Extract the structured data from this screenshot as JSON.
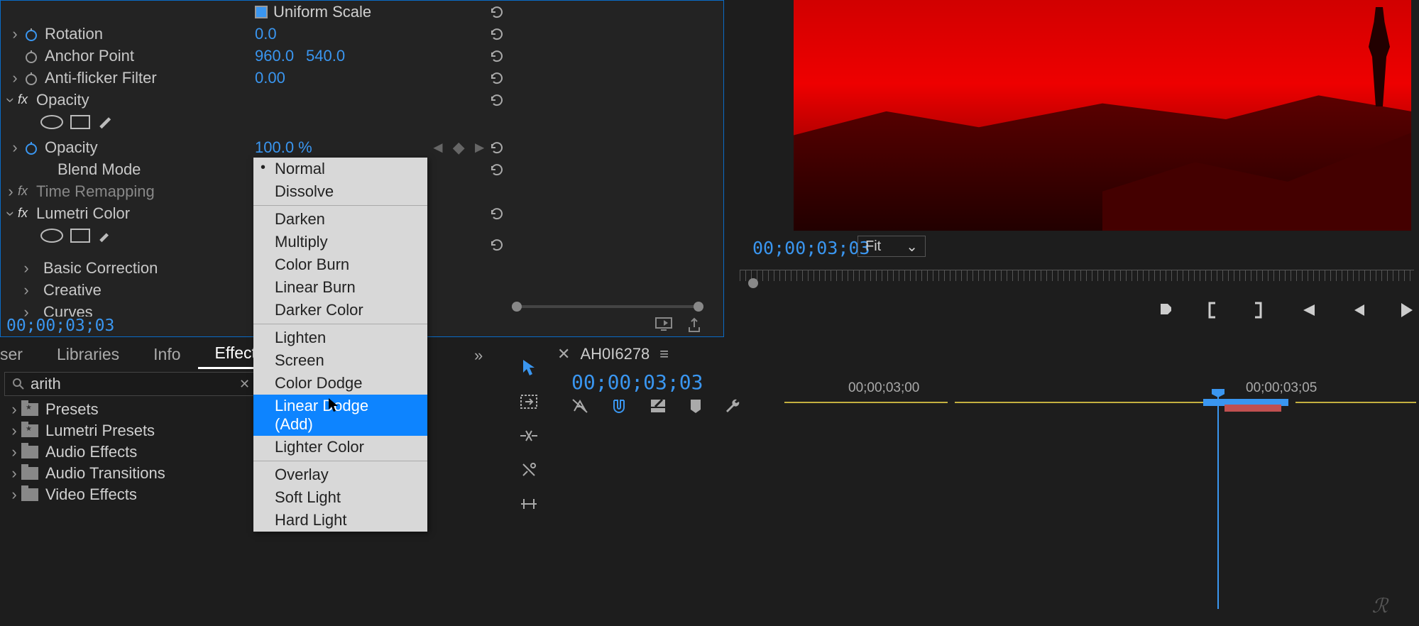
{
  "effects_panel": {
    "uniform_scale_label": "Uniform Scale",
    "rotation_label": "Rotation",
    "rotation_value": "0.0",
    "anchor_point_label": "Anchor Point",
    "anchor_x": "960.0",
    "anchor_y": "540.0",
    "anti_flicker_label": "Anti-flicker Filter",
    "anti_flicker_value": "0.00",
    "opacity_effect_label": "Opacity",
    "opacity_prop_label": "Opacity",
    "opacity_value": "100.0 %",
    "blend_mode_label": "Blend Mode",
    "blend_mode_value": "Normal",
    "time_remapping_label": "Time Remapping",
    "lumetri_label": "Lumetri Color",
    "basic_correction_label": "Basic Correction",
    "creative_label": "Creative",
    "curves_label": "Curves",
    "timecode": "00;00;03;03"
  },
  "blend_menu": {
    "items_g1": [
      "Normal",
      "Dissolve"
    ],
    "items_g2": [
      "Darken",
      "Multiply",
      "Color Burn",
      "Linear Burn",
      "Darker Color"
    ],
    "items_g3": [
      "Lighten",
      "Screen",
      "Color Dodge",
      "Linear Dodge (Add)",
      "Lighter Color"
    ],
    "items_g4": [
      "Overlay",
      "Soft Light",
      "Hard Light"
    ],
    "selected": "Normal",
    "highlighted": "Linear Dodge (Add)"
  },
  "tabs": {
    "browser": "ser",
    "libraries": "Libraries",
    "info": "Info",
    "effects": "Effects"
  },
  "search": {
    "query": "arith"
  },
  "folders": [
    "Presets",
    "Lumetri Presets",
    "Audio Effects",
    "Audio Transitions",
    "Video Effects"
  ],
  "preview": {
    "timecode": "00;00;03;03",
    "fit_label": "Fit"
  },
  "timeline": {
    "sequence_name": "AH0I6278",
    "timecode": "00;00;03;03",
    "time_labels": [
      "00;00;03;00",
      "00;00;03;05"
    ]
  }
}
